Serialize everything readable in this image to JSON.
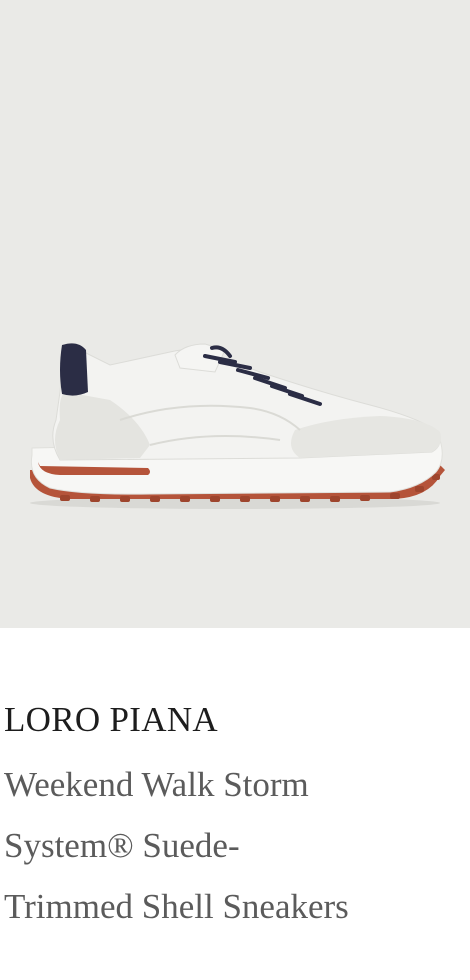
{
  "product": {
    "image_alt": "Weekend Walk Storm System® Suede-Trimmed Shell Sneakers",
    "brand": "LORO PIANA",
    "name_line_1": "Weekend Walk Storm",
    "name_line_2": "System® Suede-",
    "name_line_3": "Trimmed Shell Sneakers"
  },
  "colors": {
    "image_background": "#eaeae7",
    "brand_text": "#1d1d1d",
    "name_text": "#5b5b5b",
    "sole_accent": "#b5543a",
    "heel_tab": "#2b2d45"
  }
}
